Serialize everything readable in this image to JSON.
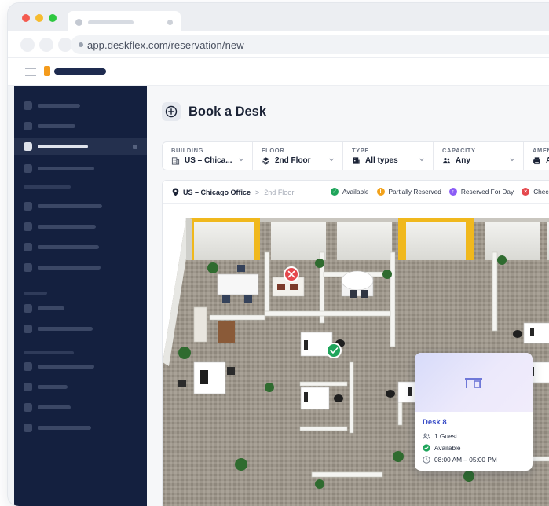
{
  "browser": {
    "url": "app.deskflex.com/reservation/new"
  },
  "page": {
    "title": "Book a Desk"
  },
  "filters": [
    {
      "label": "BUILDING",
      "value": "US – Chica...",
      "icon": "building-icon"
    },
    {
      "label": "FLOOR",
      "value": "2nd Floor",
      "icon": "layers-icon"
    },
    {
      "label": "TYPE",
      "value": "All types",
      "icon": "desk-type-icon"
    },
    {
      "label": "CAPACITY",
      "value": "Any",
      "icon": "people-icon"
    },
    {
      "label": "AMENI",
      "value": "A",
      "icon": "printer-icon"
    }
  ],
  "location": {
    "building": "US – Chicago Office",
    "separator": ">",
    "floor": "2nd Floor"
  },
  "legend": [
    {
      "label": "Available",
      "color": "#1fa55b"
    },
    {
      "label": "Partially Reserved",
      "color": "#f2a21b"
    },
    {
      "label": "Reserved For Day",
      "color": "#8b5cf6"
    },
    {
      "label": "Check",
      "color": "#e5484d"
    }
  ],
  "desk_popup": {
    "name": "Desk 8",
    "guests": "1 Guest",
    "status": "Available",
    "hours": "08:00 AM – 05:00 PM"
  },
  "colors": {
    "sidebar": "#14203f",
    "accent": "#3b4fc8",
    "brand": "#f49b1c",
    "available": "#1fa55b",
    "unavailable": "#e5484d"
  }
}
